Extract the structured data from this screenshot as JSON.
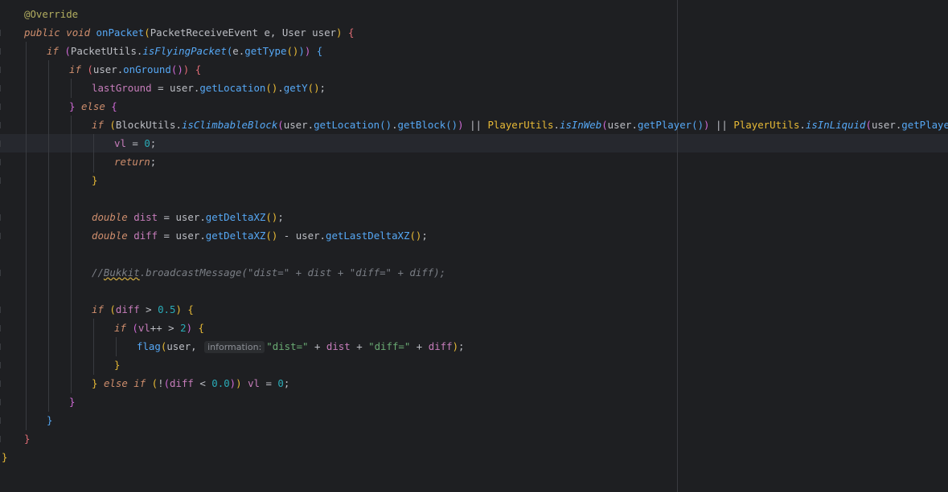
{
  "code": {
    "annotation": "@Override",
    "kw_public": "public",
    "kw_void": "void",
    "method_name": "onPacket",
    "param_type1": "PacketReceiveEvent",
    "param_name1": "e",
    "param_type2": "User",
    "param_name2": "user",
    "kw_if": "if",
    "kw_else": "else",
    "kw_double": "double",
    "kw_return": "return",
    "packet_utils": "PacketUtils",
    "is_flying_packet": "isFlyingPacket",
    "get_type": "getType",
    "on_ground": "onGround",
    "last_ground": "lastGround",
    "get_location": "getLocation",
    "get_y": "getY",
    "block_utils": "BlockUtils",
    "is_climbable_block": "isClimbableBlock",
    "get_block": "getBlock",
    "player_utils": "PlayerUtils",
    "is_in_web": "isInWeb",
    "get_player": "getPlayer",
    "is_in_liquid": "isInLiquid",
    "vl": "vl",
    "zero": "0",
    "dist": "dist",
    "diff": "diff",
    "get_delta_xz": "getDeltaXZ",
    "get_last_delta_xz": "getLastDeltaXZ",
    "comment_prefix": "//",
    "comment_bukkit": "Bukkit",
    "comment_rest": ".broadcastMessage(\"dist=\" + dist + \"diff=\" + diff);",
    "num_half": "0.5",
    "num_two": "2",
    "num_zero_float": "0.0",
    "flag": "flag",
    "param_hint": "information:",
    "str_dist": "\"dist=\"",
    "str_diff": "\"diff=\""
  }
}
